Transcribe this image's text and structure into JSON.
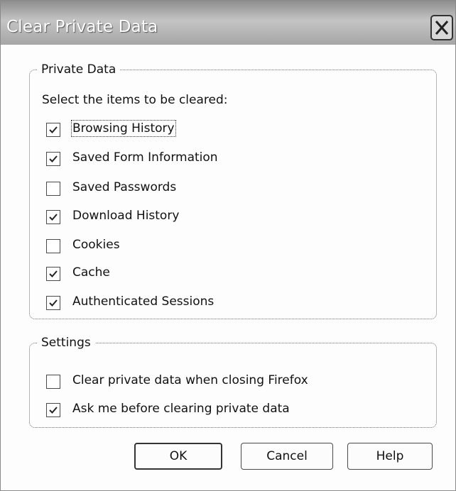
{
  "dialog": {
    "title": "Clear Private Data"
  },
  "private_data": {
    "legend": "Private Data",
    "prompt": "Select the items to be cleared:",
    "items": [
      {
        "label": "Browsing History",
        "checked": true
      },
      {
        "label": "Saved Form Information",
        "checked": true
      },
      {
        "label": "Saved Passwords",
        "checked": false
      },
      {
        "label": "Download History",
        "checked": true
      },
      {
        "label": "Cookies",
        "checked": false
      },
      {
        "label": "Cache",
        "checked": true
      },
      {
        "label": "Authenticated Sessions",
        "checked": true
      }
    ]
  },
  "settings": {
    "legend": "Settings",
    "items": [
      {
        "label": "Clear private data when closing Firefox",
        "checked": false
      },
      {
        "label": "Ask me before clearing private data",
        "checked": true
      }
    ]
  },
  "buttons": {
    "ok": "OK",
    "cancel": "Cancel",
    "help": "Help"
  },
  "icons": {
    "close": "close-icon",
    "check": "checkmark-icon"
  }
}
